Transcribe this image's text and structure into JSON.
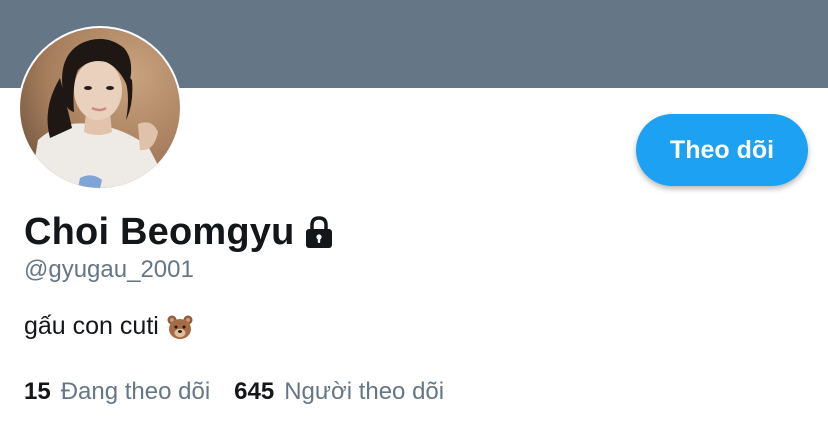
{
  "profile": {
    "display_name": "Choi Beomgyu",
    "handle": "@gyugau_2001",
    "bio": "gấu con cuti",
    "bio_emoji": "bear-face-icon",
    "protected": true,
    "follow_button_label": "Theo dõi"
  },
  "stats": {
    "following_count": "15",
    "following_label": "Đang theo dõi",
    "followers_count": "645",
    "followers_label": "Người theo dõi"
  },
  "colors": {
    "banner": "#657786",
    "accent": "#1da1f2",
    "text_primary": "#14171a",
    "text_secondary": "#657786"
  }
}
